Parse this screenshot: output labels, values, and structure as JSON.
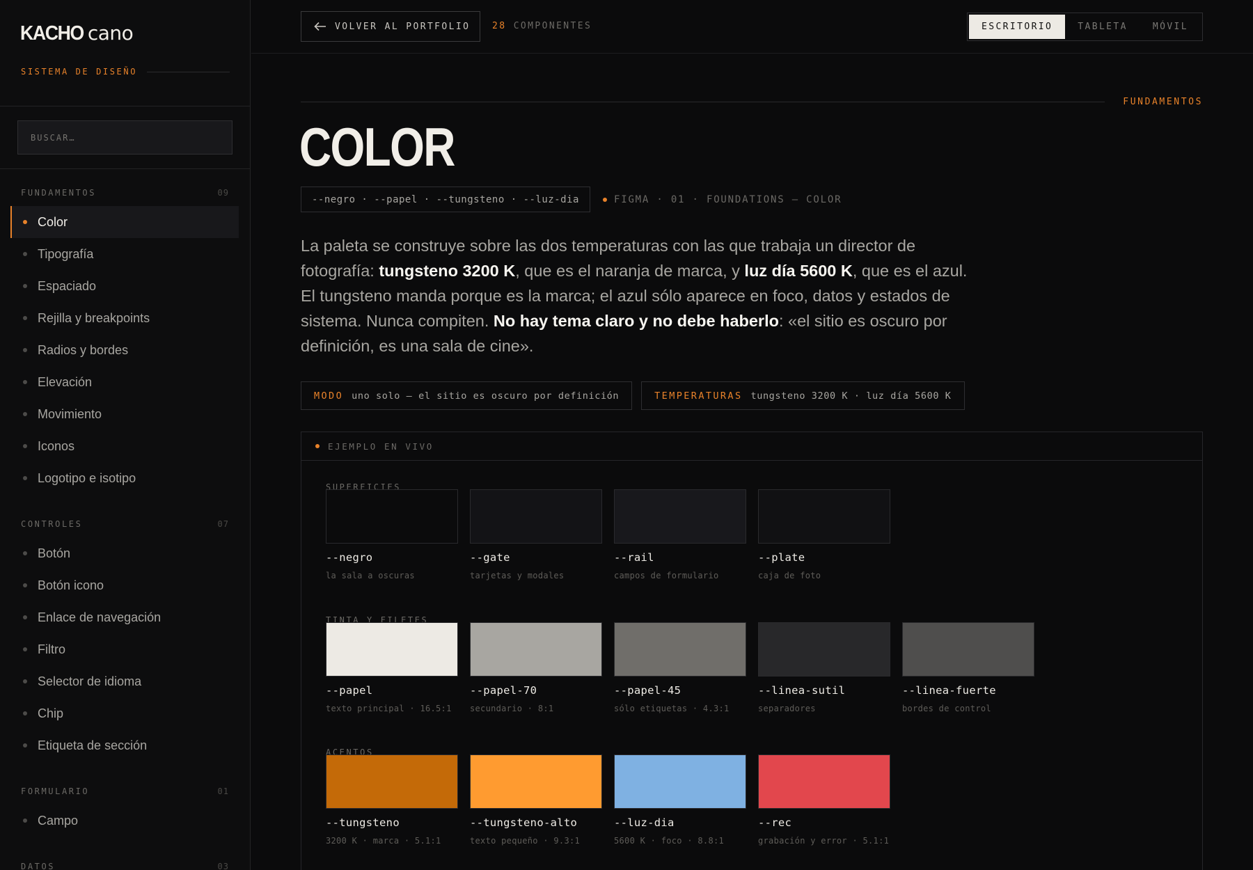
{
  "sidebar": {
    "logo_bold": "KACHO",
    "logo_light": "cano",
    "tagline": "SISTEMA DE DISEÑO",
    "search_placeholder": "BUSCAR…",
    "sections": [
      {
        "label": "FUNDAMENTOS",
        "count": "09",
        "items": [
          {
            "label": "Color",
            "active": true
          },
          {
            "label": "Tipografía"
          },
          {
            "label": "Espaciado"
          },
          {
            "label": "Rejilla y breakpoints"
          },
          {
            "label": "Radios y bordes"
          },
          {
            "label": "Elevación"
          },
          {
            "label": "Movimiento"
          },
          {
            "label": "Iconos"
          },
          {
            "label": "Logotipo e isotipo"
          }
        ]
      },
      {
        "label": "CONTROLES",
        "count": "07",
        "items": [
          {
            "label": "Botón"
          },
          {
            "label": "Botón icono"
          },
          {
            "label": "Enlace de navegación"
          },
          {
            "label": "Filtro"
          },
          {
            "label": "Selector de idioma"
          },
          {
            "label": "Chip"
          },
          {
            "label": "Etiqueta de sección"
          }
        ]
      },
      {
        "label": "FORMULARIO",
        "count": "01",
        "items": [
          {
            "label": "Campo"
          }
        ]
      },
      {
        "label": "DATOS",
        "count": "03",
        "items": []
      }
    ]
  },
  "topbar": {
    "back_label": "VOLVER AL PORTFOLIO",
    "component_count": "28",
    "component_label": "COMPONENTES",
    "viewports": [
      {
        "label": "ESCRITORIO",
        "active": true
      },
      {
        "label": "TABLETA"
      },
      {
        "label": "MÓVIL"
      }
    ]
  },
  "main": {
    "section_tag": "FUNDAMENTOS",
    "title": "COLOR",
    "tokens": "--negro · --papel · --tungsteno · --luz-dia",
    "figma_ref": "FIGMA · 01 · FOUNDATIONS — COLOR",
    "intro": {
      "p1": "La paleta se construye sobre las dos temperaturas con las que trabaja un director de fotografía: ",
      "b1": "tungsteno 3200 K",
      "p2": ", que es el naranja de marca, y ",
      "b2": "luz día 5600 K",
      "p3": ", que es el azul. El tungsteno manda porque es la marca; el azul sólo aparece en foco, datos y estados de sistema. Nunca compiten. ",
      "b3": "No hay tema claro y no debe haberlo",
      "p4": ": «el sitio es oscuro por definición, es una sala de cine»."
    },
    "meta": [
      {
        "key": "MODO",
        "value": "uno solo — el sitio es oscuro por definición"
      },
      {
        "key": "TEMPERATURAS",
        "value": "tungsteno 3200 K · luz día 5600 K"
      }
    ],
    "live_label": "EJEMPLO EN VIVO",
    "groups": [
      {
        "label": "SUPERFICIES",
        "swatches": [
          {
            "name": "--negro",
            "desc": "la sala a oscuras",
            "color": "#0b0b0c"
          },
          {
            "name": "--gate",
            "desc": "tarjetas y modales",
            "color": "#131316"
          },
          {
            "name": "--rail",
            "desc": "campos de formulario",
            "color": "#18181c"
          },
          {
            "name": "--plate",
            "desc": "caja de foto",
            "color": "#111113"
          }
        ]
      },
      {
        "label": "TINTA Y FILETES",
        "swatches": [
          {
            "name": "--papel",
            "desc": "texto principal · 16.5:1",
            "color": "#edeae4"
          },
          {
            "name": "--papel-70",
            "desc": "secundario · 8:1",
            "color": "#a8a6a1"
          },
          {
            "name": "--papel-45",
            "desc": "sólo etiquetas · 4.3:1",
            "color": "#706e6a"
          },
          {
            "name": "--linea-sutil",
            "desc": "separadores",
            "color": "#28282a"
          },
          {
            "name": "--linea-fuerte",
            "desc": "bordes de control",
            "color": "#4f4e4d"
          }
        ]
      },
      {
        "label": "ACENTOS",
        "swatches": [
          {
            "name": "--tungsteno",
            "desc": "3200 K · marca · 5.1:1",
            "color": "#c46a08"
          },
          {
            "name": "--tungsteno-alto",
            "desc": "texto pequeño · 9.3:1",
            "color": "#ff9b30"
          },
          {
            "name": "--luz-dia",
            "desc": "5600 K · foco · 8.8:1",
            "color": "#7fb1e2"
          },
          {
            "name": "--rec",
            "desc": "grabación y error · 5.1:1",
            "color": "#e2474d"
          }
        ]
      }
    ]
  },
  "colors": {
    "accent": "#e8822a",
    "background": "#0b0b0c",
    "paper": "#edeae4"
  }
}
